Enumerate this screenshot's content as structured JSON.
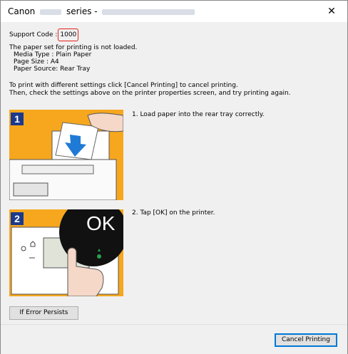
{
  "window": {
    "title_prefix": "Canon",
    "title_suffix": "series -",
    "close_glyph": "✕"
  },
  "support": {
    "label": "Support Code :",
    "code": "1000",
    "code_color": "#e2231a"
  },
  "message": {
    "line1": "The paper set for printing is not loaded.",
    "media_type": "Media Type : Plain Paper",
    "page_size": "Page Size : A4",
    "paper_source": "Paper Source: Rear Tray",
    "instr1": "To print with different settings click [Cancel Printing] to cancel printing.",
    "instr2": "Then, check the settings above on the printer properties screen, and try printing again."
  },
  "steps": [
    {
      "number": "1",
      "text": "1.  Load paper into the rear tray correctly."
    },
    {
      "number": "2",
      "text": "2.  Tap [OK] on the printer.",
      "ok_label": "OK"
    }
  ],
  "buttons": {
    "if_error": "If Error Persists",
    "cancel": "Cancel Printing"
  },
  "colors": {
    "illustration_bg": "#f6a71e",
    "step_badge": "#1b3a8c",
    "arrow": "#1f7ad6"
  }
}
